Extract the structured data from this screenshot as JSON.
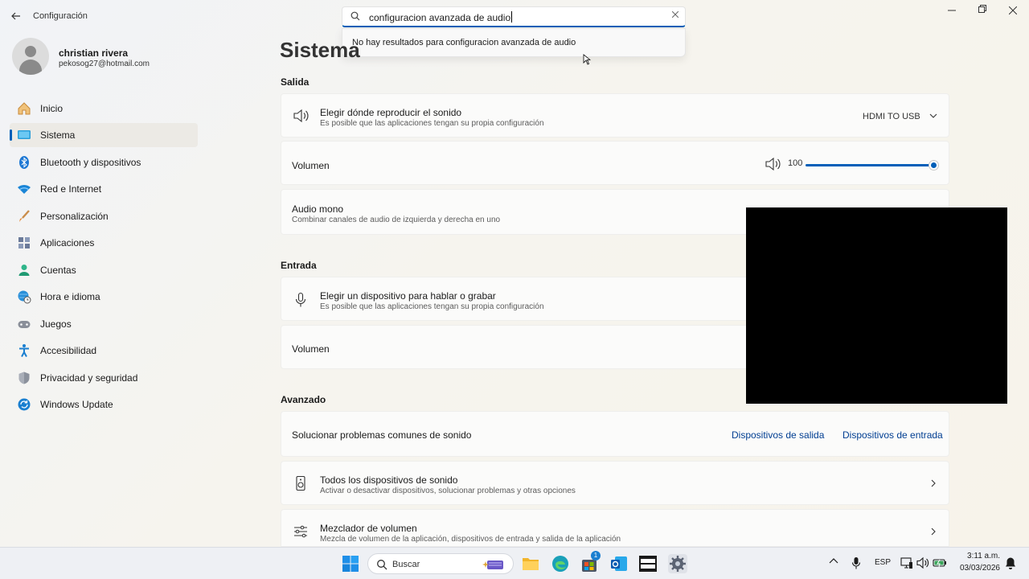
{
  "window": {
    "title": "Configuración",
    "back_icon": "arrow-left-icon",
    "minimize_icon": "minimize-icon",
    "maximize_icon": "restore-icon",
    "close_icon": "close-icon"
  },
  "search": {
    "value": "configuracion avanzada de audio",
    "no_results": "No hay resultados para configuracion avanzada de audio",
    "clear_icon": "close-icon"
  },
  "profile": {
    "name": "christian rivera",
    "email": "pekosog27@hotmail.com"
  },
  "sidebar": {
    "active_color": "#005fb8",
    "items": [
      {
        "label": "Inicio",
        "icon": "home-icon"
      },
      {
        "label": "Sistema",
        "icon": "system-icon",
        "active": true
      },
      {
        "label": "Bluetooth y dispositivos",
        "icon": "bluetooth-icon"
      },
      {
        "label": "Red e Internet",
        "icon": "wifi-icon"
      },
      {
        "label": "Personalización",
        "icon": "brush-icon"
      },
      {
        "label": "Aplicaciones",
        "icon": "apps-icon"
      },
      {
        "label": "Cuentas",
        "icon": "account-icon"
      },
      {
        "label": "Hora e idioma",
        "icon": "globe-clock-icon"
      },
      {
        "label": "Juegos",
        "icon": "gamepad-icon"
      },
      {
        "label": "Accesibilidad",
        "icon": "accessibility-icon"
      },
      {
        "label": "Privacidad y seguridad",
        "icon": "shield-icon"
      },
      {
        "label": "Windows Update",
        "icon": "update-icon"
      }
    ]
  },
  "main": {
    "title": "Sistema",
    "salida": {
      "header": "Salida",
      "output_device": {
        "title": "Elegir dónde reproducir el sonido",
        "subtitle": "Es posible que las aplicaciones tengan su propia configuración",
        "selected": "HDMI TO USB"
      },
      "volume": {
        "label": "Volumen",
        "value": "100",
        "level": 1.0
      },
      "mono": {
        "title": "Audio mono",
        "subtitle": "Combinar canales de audio de izquierda y derecha en uno"
      }
    },
    "entrada": {
      "header": "Entrada",
      "input_device": {
        "title": "Elegir un dispositivo para hablar o grabar",
        "subtitle": "Es posible que las aplicaciones tengan su propia configuración"
      },
      "volume": {
        "label": "Volumen"
      }
    },
    "avanzado": {
      "header": "Avanzado",
      "troubleshoot": {
        "title": "Solucionar problemas comunes de sonido",
        "link_output": "Dispositivos de salida",
        "link_input": "Dispositivos de entrada"
      },
      "all_devices": {
        "title": "Todos los dispositivos de sonido",
        "subtitle": "Activar o desactivar dispositivos, solucionar problemas y otras opciones"
      },
      "mixer": {
        "title": "Mezclador de volumen",
        "subtitle": "Mezcla de volumen de la aplicación, dispositivos de entrada y salida de la aplicación"
      }
    }
  },
  "taskbar": {
    "search_label": "Buscar",
    "language": "ESP",
    "time": "3:11 a.m.",
    "date": "03/03/2026",
    "store_badge": "1",
    "apps": [
      "start-icon",
      "file-explorer-icon",
      "edge-icon",
      "store-icon",
      "outlook-icon",
      "game-app-icon",
      "settings-icon"
    ]
  }
}
